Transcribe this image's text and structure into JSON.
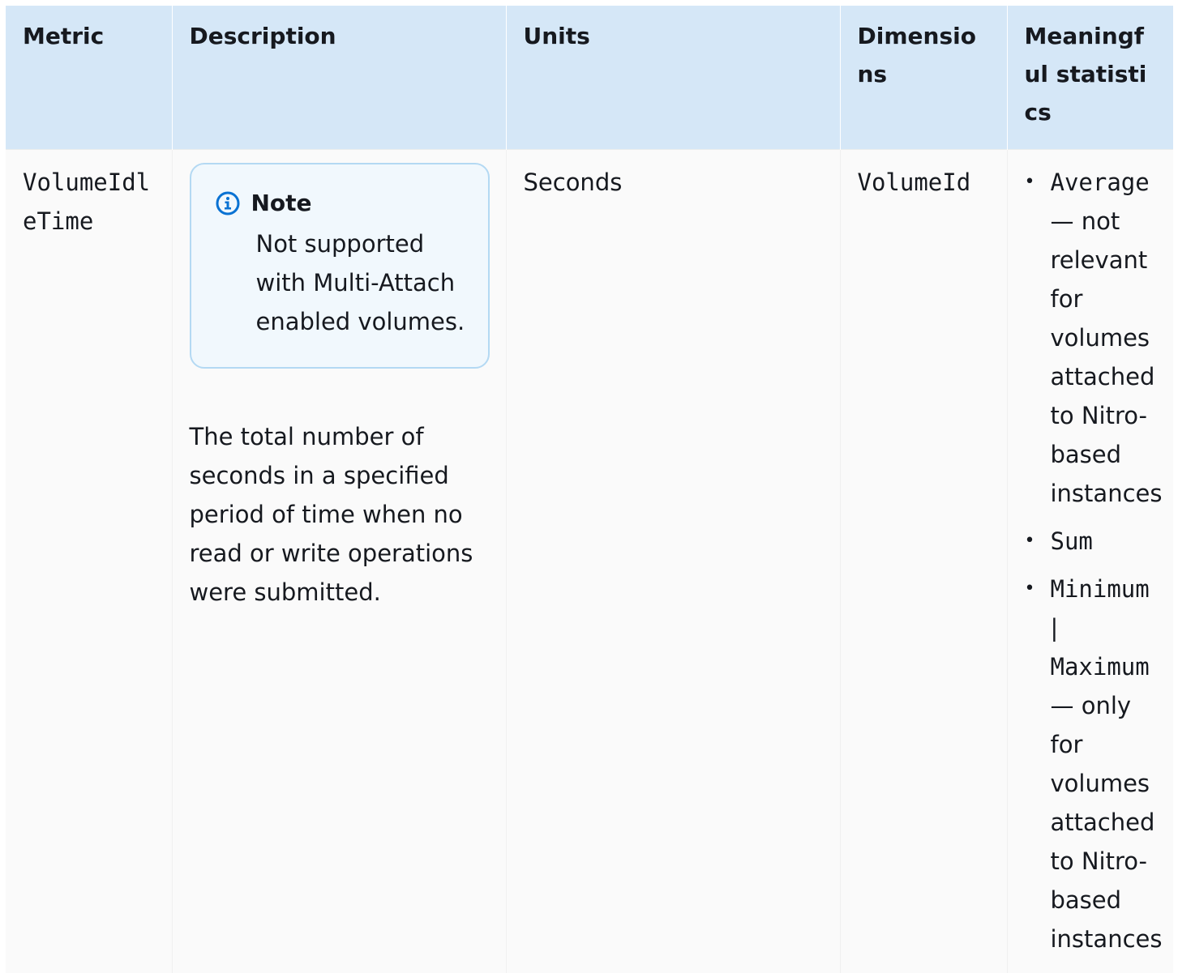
{
  "table": {
    "headers": [
      "Metric",
      "Description",
      "Units",
      "Dimensions",
      "Meaningful statistics"
    ],
    "row": {
      "metric": "VolumeIdleTime",
      "note": {
        "title": "Note",
        "text": "Not supported with Multi-Attach enabled volumes."
      },
      "description": "The total number of seconds in a specified period of time when no read or write operations were submitted.",
      "units": "Seconds",
      "dimensions": "VolumeId",
      "statistics": [
        {
          "code": "Average",
          "text": "— not relevant for volumes attached to Nitro-based instances"
        },
        {
          "code": "Sum",
          "text": ""
        },
        {
          "code": "Minimum",
          "separator": "|",
          "code2": "Maximum",
          "text": "— only for volumes attached to Nitro-based instances"
        }
      ]
    }
  },
  "icons": {
    "note": "info-icon"
  },
  "colors": {
    "header_bg": "#d5e7f7",
    "note_border": "#b4d9f3",
    "note_bg": "#f1f8fd",
    "icon_blue": "#0972d3"
  }
}
